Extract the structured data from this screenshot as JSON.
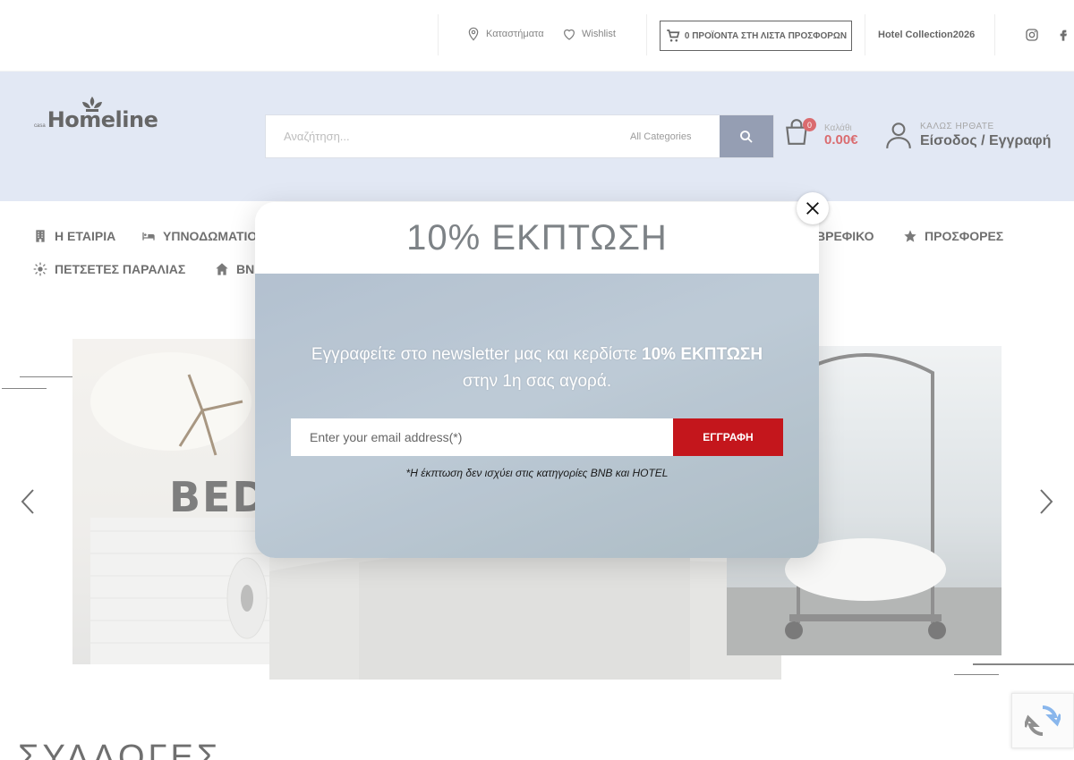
{
  "topbar": {
    "stores_label": "Καταστήματα",
    "wishlist_label": "Wishlist",
    "offers_label": "0 ΠΡΟΪΟΝΤΑ ΣΤΗ ΛΙΣΤΑ ΠΡΟΣΦΟΡΩΝ",
    "hotel_label": "Hotel Collection2026",
    "social_icons": [
      "instagram-icon",
      "facebook-icon"
    ]
  },
  "header": {
    "logo_small": "casa",
    "logo_text": "Homeline",
    "search_placeholder": "Αναζήτηση...",
    "search_category": "All Categories",
    "cart_count": "0",
    "cart_label": "Καλάθι",
    "cart_total": "0.00€",
    "user_welcome": "ΚΑΛΩΣ ΗΡΘΑΤΕ",
    "user_login": "Είσοδος / Εγγραφή",
    "bg_color": "#d3dcef",
    "accent": "#c71d22"
  },
  "nav": {
    "company": "Η ΕΤΑΙΡΙΑ",
    "bedding": "ΥΠΝΟΔΩΜΑΤΙΟ",
    "baby": "ΒΡΕΦΙΚΟ",
    "offers": "ΠΡΟΣΦΟΡΕΣ",
    "beach": "ΠΕΤΣΕΤΕΣ ΠΑΡΑΛΙΑΣ",
    "bnb": "BNB"
  },
  "hero": {
    "banner_text": "BEDD"
  },
  "section": {
    "collections_title": "ΣΥΛΛΟΓΕΣ"
  },
  "modal": {
    "title": "10% ΕΚΠΤΩΣΗ",
    "text_pre": "Εγγραφείτε στο newsletter μας και κερδίστε ",
    "text_bold": "10% ΕΚΠΤΩΣΗ",
    "text_post": "στην 1η σας αγορά.",
    "email_placeholder": "Enter your email address(*)",
    "subscribe_label": "ΕΓΓΡΑΦΗ",
    "disclaimer": "*Η έκπτωση δεν ισχύει στις κατηγορίες BNB και HOTEL",
    "button_color": "#c4161c"
  }
}
